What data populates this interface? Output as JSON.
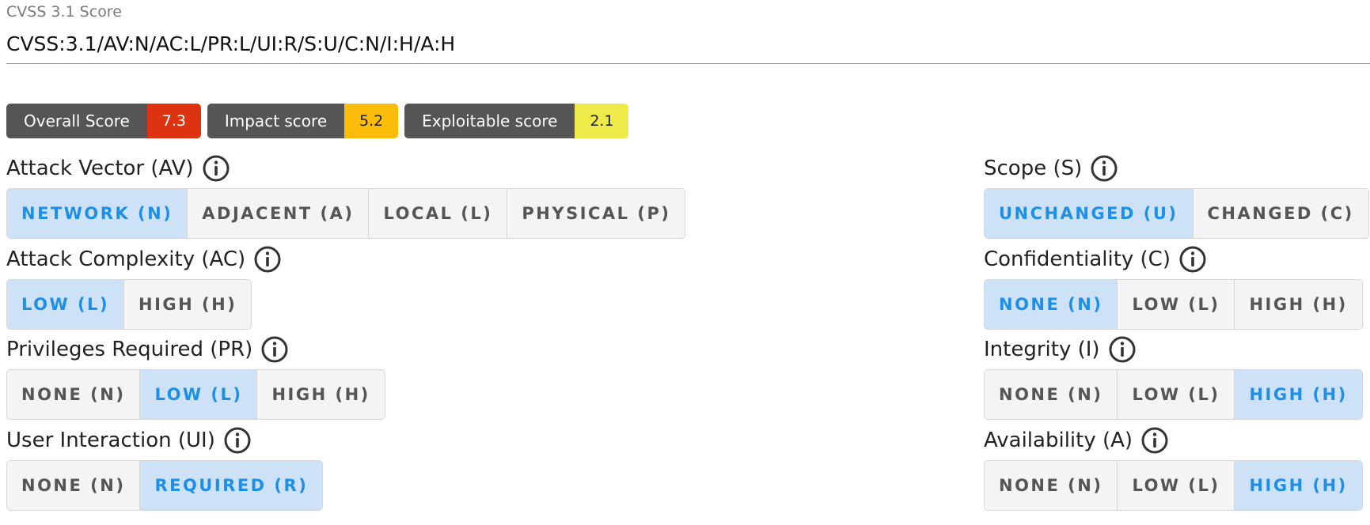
{
  "header": {
    "label": "CVSS 3.1 Score",
    "vector": "CVSS:3.1/AV:N/AC:L/PR:L/UI:R/S:U/C:N/I:H/A:H"
  },
  "scores": [
    {
      "name": "Overall Score",
      "value": "7.3",
      "color": "#dd3311"
    },
    {
      "name": "Impact score",
      "value": "5.2",
      "color": "#fbbd0a"
    },
    {
      "name": "Exploitable score",
      "value": "2.1",
      "color": "#eeea4a"
    }
  ],
  "colors": {
    "selected_bg": "#cde2f6",
    "selected_text": "#1e8fe6",
    "icon": "info-circle-icon"
  },
  "metrics": {
    "av": {
      "title": "Attack Vector (AV)",
      "options": [
        "NETWORK (N)",
        "ADJACENT (A)",
        "LOCAL (L)",
        "PHYSICAL (P)"
      ],
      "selected": 0
    },
    "ac": {
      "title": "Attack Complexity (AC)",
      "options": [
        "LOW (L)",
        "HIGH (H)"
      ],
      "selected": 0
    },
    "pr": {
      "title": "Privileges Required (PR)",
      "options": [
        "NONE (N)",
        "LOW (L)",
        "HIGH (H)"
      ],
      "selected": 1
    },
    "ui": {
      "title": "User Interaction (UI)",
      "options": [
        "NONE (N)",
        "REQUIRED (R)"
      ],
      "selected": 1
    },
    "s": {
      "title": "Scope (S)",
      "options": [
        "UNCHANGED (U)",
        "CHANGED (C)"
      ],
      "selected": 0
    },
    "c": {
      "title": "Confidentiality (C)",
      "options": [
        "NONE (N)",
        "LOW (L)",
        "HIGH (H)"
      ],
      "selected": 0
    },
    "i": {
      "title": "Integrity (I)",
      "options": [
        "NONE (N)",
        "LOW (L)",
        "HIGH (H)"
      ],
      "selected": 2
    },
    "a": {
      "title": "Availability (A)",
      "options": [
        "NONE (N)",
        "LOW (L)",
        "HIGH (H)"
      ],
      "selected": 2
    }
  }
}
